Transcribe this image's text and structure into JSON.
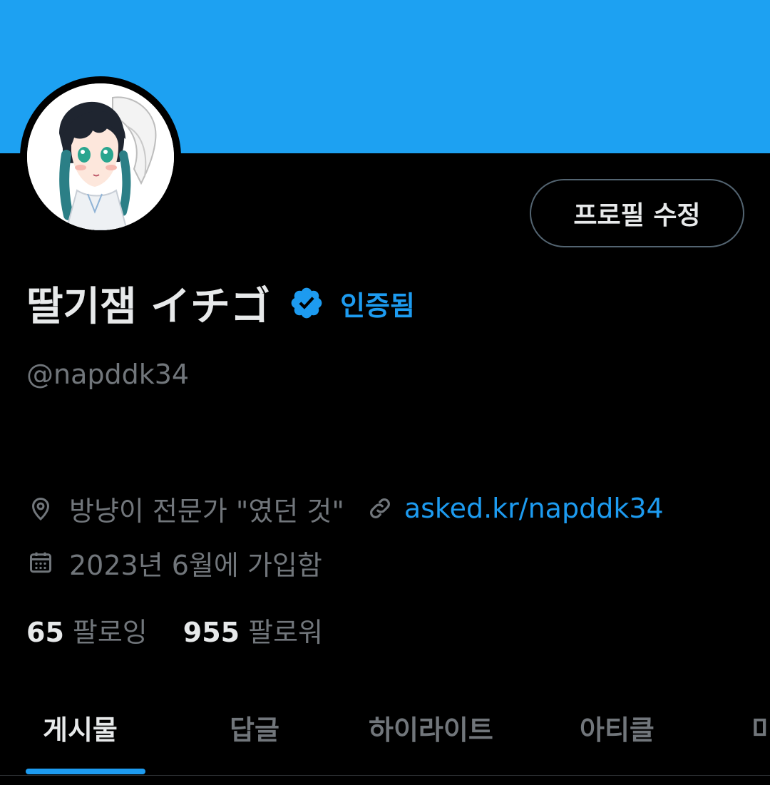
{
  "profile": {
    "display_name": "딸기잼 イチゴ",
    "verified_label": "인증됨",
    "handle": "@napddk34",
    "location": "방냥이 전문가 \"였던 것\"",
    "link": "asked.kr/napddk34",
    "joined": "2023년 6월에 가입함",
    "following_count": "65",
    "following_label": "팔로잉",
    "followers_count": "955",
    "followers_label": "팔로워"
  },
  "actions": {
    "edit_profile_label": "프로필 수정"
  },
  "tabs": [
    {
      "label": "게시물",
      "active": true
    },
    {
      "label": "답글",
      "active": false
    },
    {
      "label": "하이라이트",
      "active": false
    },
    {
      "label": "아티클",
      "active": false
    },
    {
      "label": "미",
      "active": false
    }
  ],
  "icons": {
    "verified": "verified-badge-icon",
    "location": "location-pin-icon",
    "link": "link-icon",
    "calendar": "calendar-icon"
  },
  "colors": {
    "banner": "#1da1f2",
    "accent": "#1d9bf0",
    "background": "#000000",
    "text_primary": "#e7e9ea",
    "text_secondary": "#71767b",
    "border": "#536471"
  }
}
